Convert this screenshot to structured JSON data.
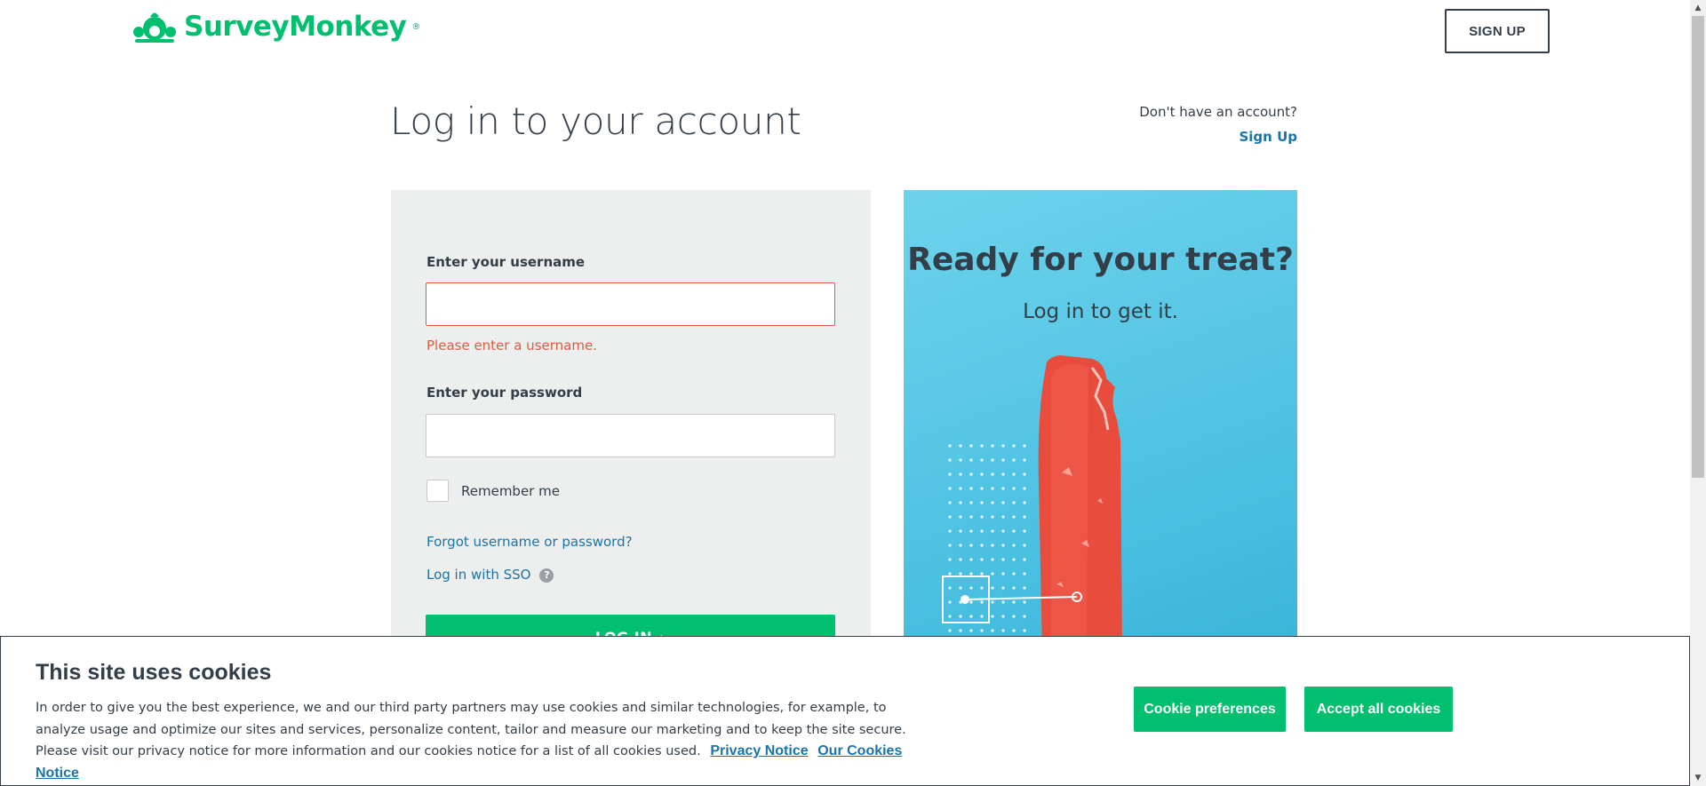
{
  "brand": {
    "name": "SurveyMonkey",
    "reg_mark": "®",
    "color": "#00bf6f"
  },
  "header": {
    "signup_button": "SIGN UP"
  },
  "page": {
    "title": "Log in to your account",
    "no_account_text": "Don't have an account?",
    "signup_link": "Sign Up"
  },
  "form": {
    "username_label": "Enter your username",
    "username_value": "",
    "username_error": "Please enter a username.",
    "password_label": "Enter your password",
    "password_value": "",
    "remember_label": "Remember me",
    "remember_checked": false,
    "forgot_link": "Forgot username or password?",
    "sso_link": "Log in with SSO",
    "help_icon": "?",
    "login_button": "LOG IN",
    "login_arrow": "›"
  },
  "promo": {
    "title": "Ready for your treat?",
    "subtitle": "Log in to get it."
  },
  "cookies": {
    "title": "This site uses cookies",
    "body": "In order to give you the best experience, we and our third party partners may use cookies and similar technologies, for example, to analyze usage and optimize our sites and services, personalize content, tailor and measure our marketing and to keep the site secure. Please visit our privacy notice for more information and our cookies notice for a list of all cookies used.",
    "privacy_link": "Privacy Notice",
    "cookies_link": "Our Cookies Notice",
    "preferences_button": "Cookie preferences",
    "accept_button": "Accept all cookies"
  },
  "colors": {
    "accent": "#00bf6f",
    "link": "#1a74a8",
    "error": "#e05b3f",
    "text": "#333e48"
  }
}
